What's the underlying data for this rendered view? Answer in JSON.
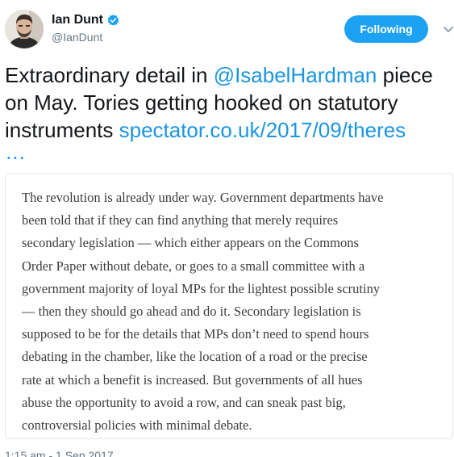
{
  "author": {
    "display_name": "Ian Dunt",
    "handle": "@IanDunt",
    "verified_icon": "verified-badge-icon",
    "avatar_icon": "profile-photo"
  },
  "follow_button": {
    "label": "Following"
  },
  "menu_icon": "chevron-down-icon",
  "tweet": {
    "line1_text": "Extraordinary detail in ",
    "mention": "@IsabelHardman",
    "line1_tail": " piece",
    "line2": "on May. Tories getting hooked on statutory",
    "line3_text": "instruments  ",
    "url": "spectator.co.uk/2017/09/theres",
    "url_ellipsis": "…"
  },
  "quote": {
    "lines": [
      "The revolution is already under way. Government departments have",
      "been told that if they can find anything that merely requires",
      "secondary legislation — which either appears on the Commons",
      "Order Paper without debate, or goes to a small committee with a",
      "government majority of loyal MPs for the lightest possible scrutiny",
      "— then they should go ahead and do it. Secondary legislation is",
      "supposed to be for the details that MPs don’t need to spend hours",
      "debating in the chamber, like the location of a road or the precise",
      "rate at which a benefit is increased. But governments of all hues",
      "abuse the opportunity to avoid a row, and can sneak past big,",
      "controversial policies with minimal debate."
    ]
  },
  "timestamp": "1:15 am - 1 Sep 2017",
  "colors": {
    "accent": "#1da1f2",
    "link": "#1b95e0",
    "text": "#14171a",
    "muted": "#657786",
    "quote_text": "#3d3d3d",
    "border": "#e1e8ed"
  }
}
